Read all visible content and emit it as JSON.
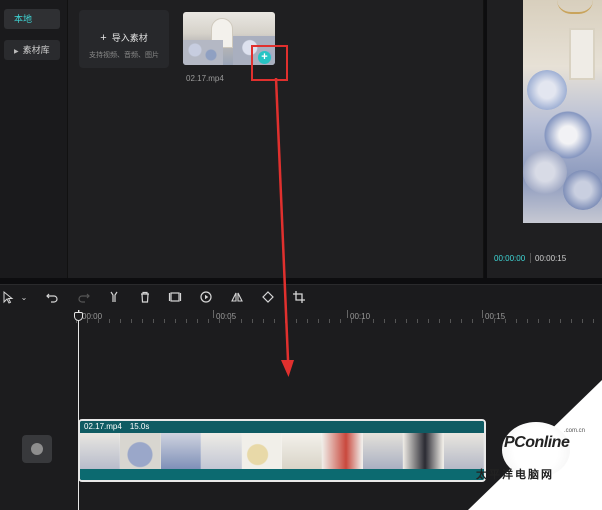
{
  "side_nav": {
    "items": [
      {
        "label": "本地",
        "active": true
      },
      {
        "label": "素材库",
        "active": false
      }
    ]
  },
  "media": {
    "import_title": "导入素材",
    "import_subtitle": "支持视频、音频、图片",
    "clip_name": "02.17.mp4",
    "add_badge": "+"
  },
  "preview": {
    "current_time": "00:00:00",
    "duration": "00:00:15"
  },
  "timeline": {
    "ticks": [
      {
        "label": "00:00"
      },
      {
        "label": "00:05"
      },
      {
        "label": "00:10"
      },
      {
        "label": "00:15"
      }
    ],
    "clip": {
      "name": "02.17.mp4",
      "length": "15.0s"
    }
  },
  "watermark": {
    "logo": "PConline",
    "logo_cn": "太平洋电脑网",
    "logo_domain": ".com.cn"
  },
  "colors": {
    "accent": "#3fd6d6",
    "highlight": "#e0302e",
    "clip_bg": "#0f5b63"
  },
  "icons": {
    "toolbar": [
      "select-icon",
      "undo-icon",
      "redo-icon",
      "split-icon",
      "delete-icon",
      "freeze-icon",
      "play-icon",
      "mirror-icon",
      "rotate-icon",
      "crop-icon"
    ]
  }
}
